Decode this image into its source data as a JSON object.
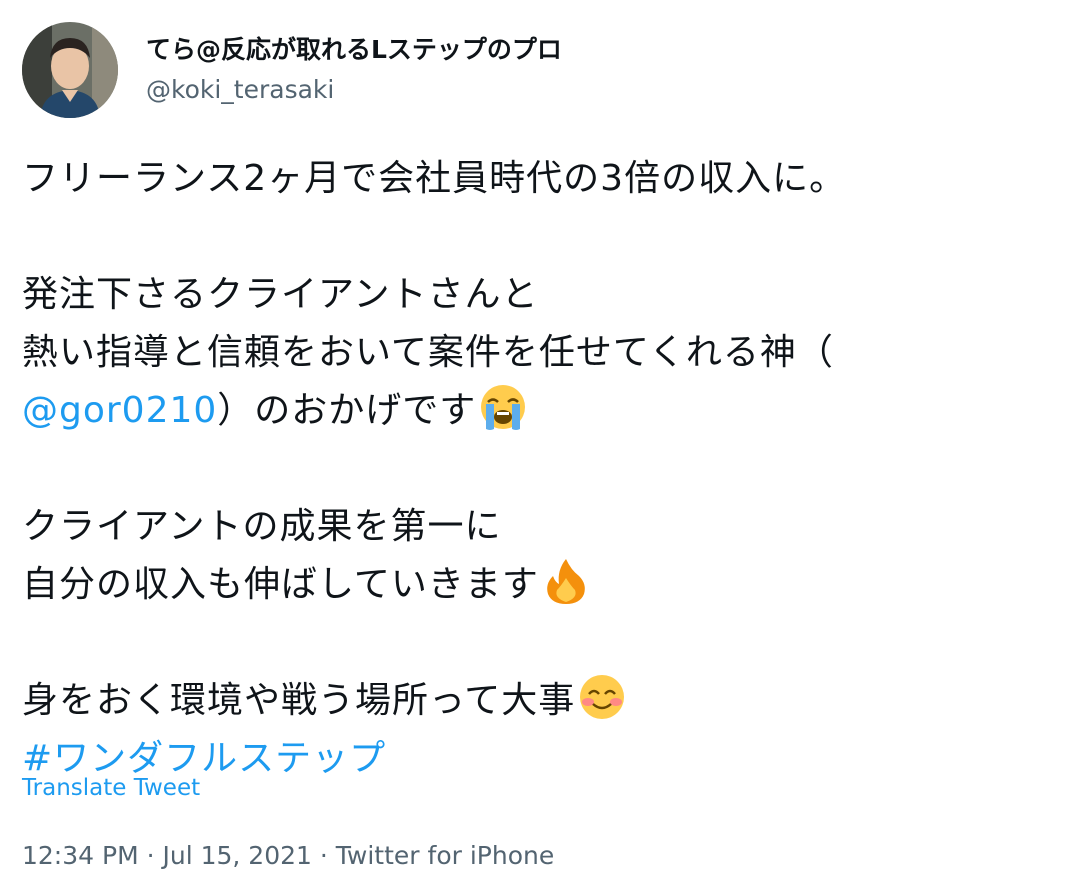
{
  "author": {
    "display_name": "てら@反応が取れるLステップのプロ",
    "handle": "@koki_terasaki"
  },
  "tweet": {
    "line1": "フリーランス2ヶ月で会社員時代の3倍の収入に。",
    "line2": "発注下さるクライアントさんと",
    "line3": "熱い指導と信頼をおいて案件を任せてくれる神（",
    "line4_mention": "@gor0210",
    "line4_rest": "）のおかげです",
    "line5": "クライアントの成果を第一に",
    "line6": "自分の収入も伸ばしていきます",
    "line7": "身をおく環境や戦う場所って大事",
    "hashtag": "#ワンダフルステップ"
  },
  "icons": {
    "crying_emoji": "loudly-crying-face-icon",
    "fire_emoji": "fire-icon",
    "smile_emoji": "smiling-face-with-blush-icon"
  },
  "translate_label": "Translate Tweet",
  "meta": {
    "time": "12:34 PM",
    "separator1": " · ",
    "date": "Jul 15, 2021",
    "separator2": " · ",
    "source": "Twitter for iPhone"
  },
  "colors": {
    "link": "#1d9bf0",
    "text": "#0f1419",
    "secondary": "#536471"
  }
}
